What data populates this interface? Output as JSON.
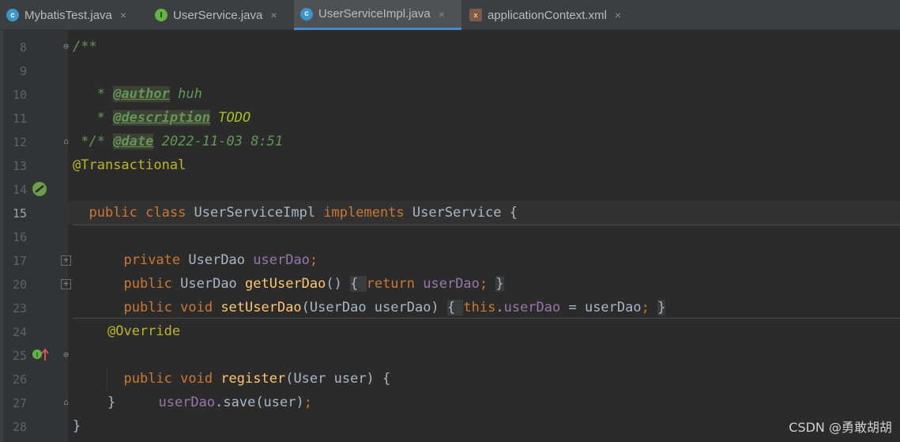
{
  "tabs": [
    {
      "label": "MybatisTest.java",
      "icon": "class-icon",
      "active": false
    },
    {
      "label": "UserService.java",
      "icon": "interface-icon",
      "active": false
    },
    {
      "label": "UserServiceImpl.java",
      "icon": "class-icon",
      "active": true
    },
    {
      "label": "applicationContext.xml",
      "icon": "xml-icon",
      "active": false
    }
  ],
  "tab_close_glyph": "×",
  "line_numbers": [
    "8",
    "9",
    "10",
    "11",
    "12",
    "13",
    "14",
    "15",
    "16",
    "17",
    "20",
    "23",
    "24",
    "25",
    "26",
    "27",
    "28"
  ],
  "code": {
    "l8": "/**",
    "l9": [
      " * ",
      "@author",
      " huh"
    ],
    "l10": [
      " * ",
      "@description",
      " TODO"
    ],
    "l11": [
      " * ",
      "@date",
      " 2022-11-03 8:51"
    ],
    "l12": " */",
    "l13": "@Transactional",
    "l14": [
      "public class ",
      "UserServiceImpl ",
      "implements ",
      "UserService {"
    ],
    "l16": [
      "private ",
      "UserDao ",
      "userDao",
      ";"
    ],
    "l17": [
      "public ",
      "UserDao ",
      "getUserDao",
      "() ",
      "{ ",
      "return ",
      "userDao",
      "; ",
      "}"
    ],
    "l20": [
      "public void ",
      "setUserDao",
      "(UserDao userDao) ",
      "{ ",
      "this",
      ".",
      "userDao",
      " = userDao",
      "; ",
      "}"
    ],
    "l24": "@Override",
    "l25": [
      "public void ",
      "register",
      "(User user) {"
    ],
    "l26": [
      "userDao",
      ".save(user)",
      ";"
    ],
    "l27": "}",
    "l28": "}"
  },
  "watermark": "CSDN @勇敢胡胡",
  "colors": {
    "keyword": "#cc7832",
    "annotation": "#bbb529",
    "method": "#ffc66d",
    "field": "#9876aa",
    "text": "#a9b7c6",
    "comment": "#629755",
    "accent": "#4a88c7"
  }
}
